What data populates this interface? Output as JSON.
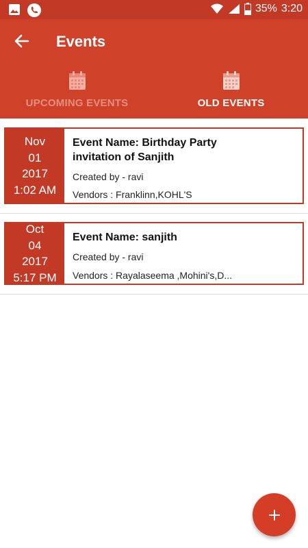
{
  "status_bar": {
    "battery": "35%",
    "time": "3:20",
    "icons": [
      "image-icon",
      "phone-icon",
      "wifi-icon",
      "signal-icon",
      "battery-icon"
    ]
  },
  "app_bar": {
    "title": "Events",
    "back_icon": "arrow-left-icon"
  },
  "tabs": [
    {
      "label": "UPCOMING EVENTS",
      "icon": "calendar-icon",
      "active": false
    },
    {
      "label": "OLD EVENTS",
      "icon": "calendar-icon",
      "active": true
    }
  ],
  "events": [
    {
      "month": "Nov",
      "day": "01",
      "year": "2017",
      "time": "1:02 AM",
      "name": "Event Name: Birthday Party invitation of Sanjith",
      "created_by": "Created by - ravi",
      "vendors": "Vendors : Franklinn,KOHL'S"
    },
    {
      "month": "Oct",
      "day": "04",
      "year": "2017",
      "time": "5:17 PM",
      "name": "Event Name: sanjith",
      "created_by": "Created by - ravi",
      "vendors": "Vendors : Rayalaseema ,Mohini's,D..."
    }
  ],
  "fab": {
    "icon": "plus-icon"
  },
  "colors": {
    "primary": "#cf4128",
    "primary_dark": "#c23a26",
    "inactive_tab": "#e38f80"
  }
}
